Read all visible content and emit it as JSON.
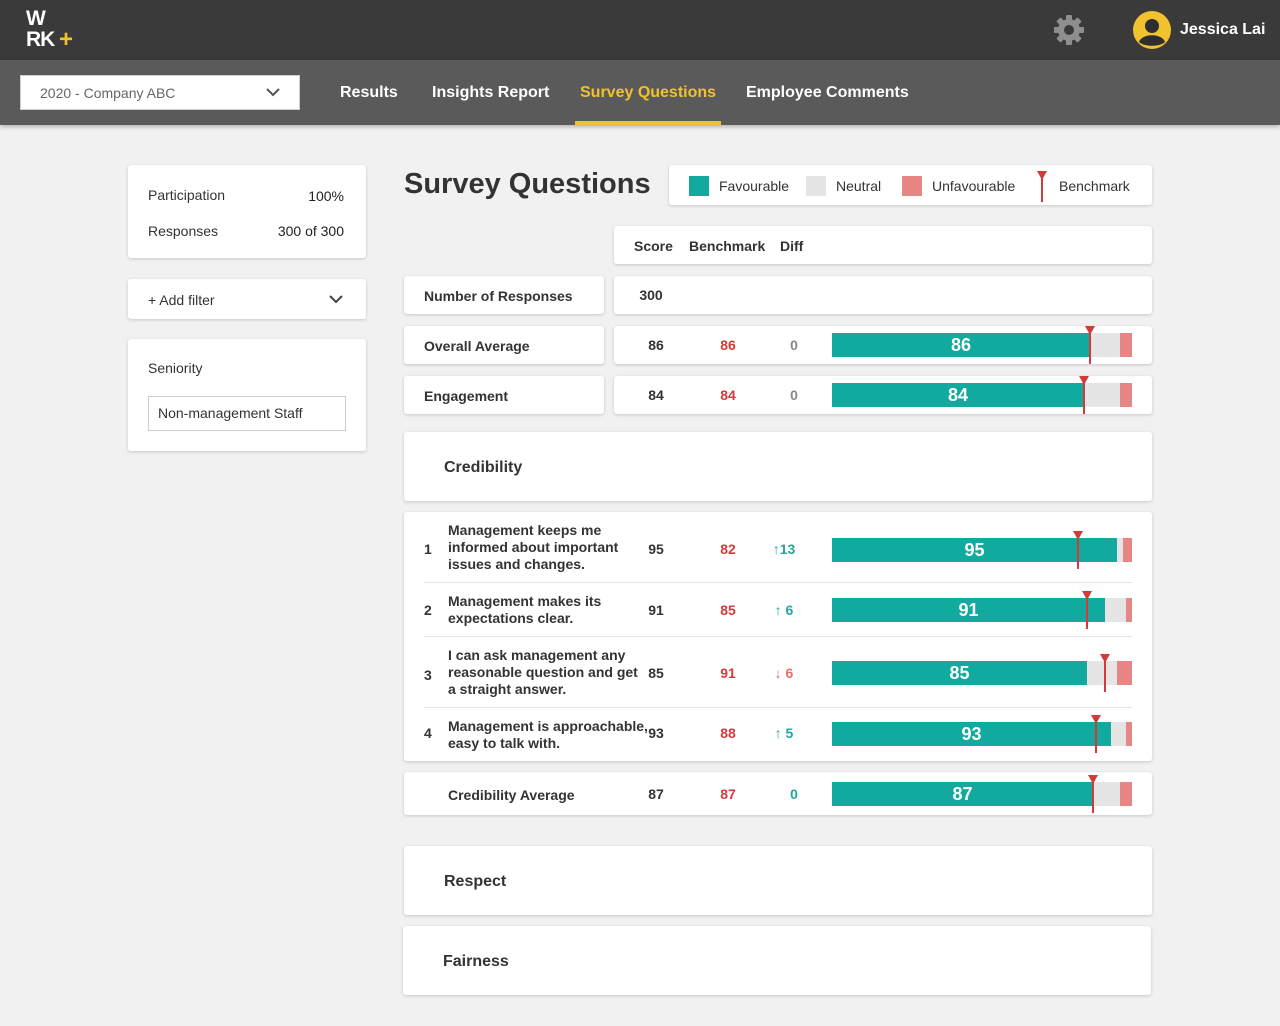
{
  "app": {
    "logo_line1": "W",
    "logo_line2": "RK",
    "logo_plus": "+",
    "user_name": "Jessica Lai"
  },
  "nav": {
    "dataset": "2020 - Company ABC",
    "tabs": [
      {
        "label": "Results",
        "active": false
      },
      {
        "label": "Insights Report",
        "active": false
      },
      {
        "label": "Survey Questions",
        "active": true
      },
      {
        "label": "Employee Comments",
        "active": false
      }
    ]
  },
  "sidebar": {
    "participation_label": "Participation",
    "participation_value": "100%",
    "responses_label": "Responses",
    "responses_value": "300 of 300",
    "add_filter_label": "+ Add filter",
    "seniority_label": "Seniority",
    "seniority_value": "Non-management Staff"
  },
  "page_title": "Survey Questions",
  "legend": {
    "favourable": "Favourable",
    "neutral": "Neutral",
    "unfavourable": "Unfavourable",
    "benchmark": "Benchmark"
  },
  "colors": {
    "favourable": "#12a99e",
    "neutral": "#e5e5e5",
    "unfavourable": "#e88585",
    "benchmark": "#d43a3a",
    "accent": "#f2c12e"
  },
  "table_header": {
    "score": "Score",
    "benchmark": "Benchmark",
    "diff": "Diff"
  },
  "summary": {
    "responses_label": "Number of Responses",
    "responses_value": "300",
    "rows": [
      {
        "label": "Overall Average",
        "score": "86",
        "benchmark": "86",
        "diff": "0",
        "favourable": 86,
        "unfavourable": 4,
        "benchmark_value": 86
      },
      {
        "label": "Engagement",
        "score": "84",
        "benchmark": "84",
        "diff": "0",
        "favourable": 84,
        "unfavourable": 4,
        "benchmark_value": 84
      }
    ]
  },
  "sections": {
    "credibility": {
      "title": "Credibility",
      "questions": [
        {
          "index": "1",
          "text": "Management keeps me informed about important issues and changes.",
          "score": "95",
          "benchmark": "82",
          "diff": "↑13",
          "trend": "up",
          "favourable": 95,
          "unfavourable": 3,
          "benchmark_value": 82
        },
        {
          "index": "2",
          "text": "Management makes its expectations clear.",
          "score": "91",
          "benchmark": "85",
          "diff": "↑ 6",
          "trend": "up",
          "favourable": 91,
          "unfavourable": 2,
          "benchmark_value": 85
        },
        {
          "index": "3",
          "text": "I can ask management any reasonable question and get a straight answer.",
          "score": "85",
          "benchmark": "91",
          "diff": "↓ 6",
          "trend": "down",
          "favourable": 85,
          "unfavourable": 5,
          "benchmark_value": 91
        },
        {
          "index": "4",
          "text": "Management is approachable, easy to talk with.",
          "score": "93",
          "benchmark": "88",
          "diff": "↑ 5",
          "trend": "up",
          "favourable": 93,
          "unfavourable": 2,
          "benchmark_value": 88
        }
      ],
      "average": {
        "label": "Credibility Average",
        "score": "87",
        "benchmark": "87",
        "diff": "0",
        "trend": "up",
        "favourable": 87,
        "unfavourable": 4,
        "benchmark_value": 87
      }
    },
    "respect": {
      "title": "Respect"
    },
    "fairness": {
      "title": "Fairness"
    }
  }
}
